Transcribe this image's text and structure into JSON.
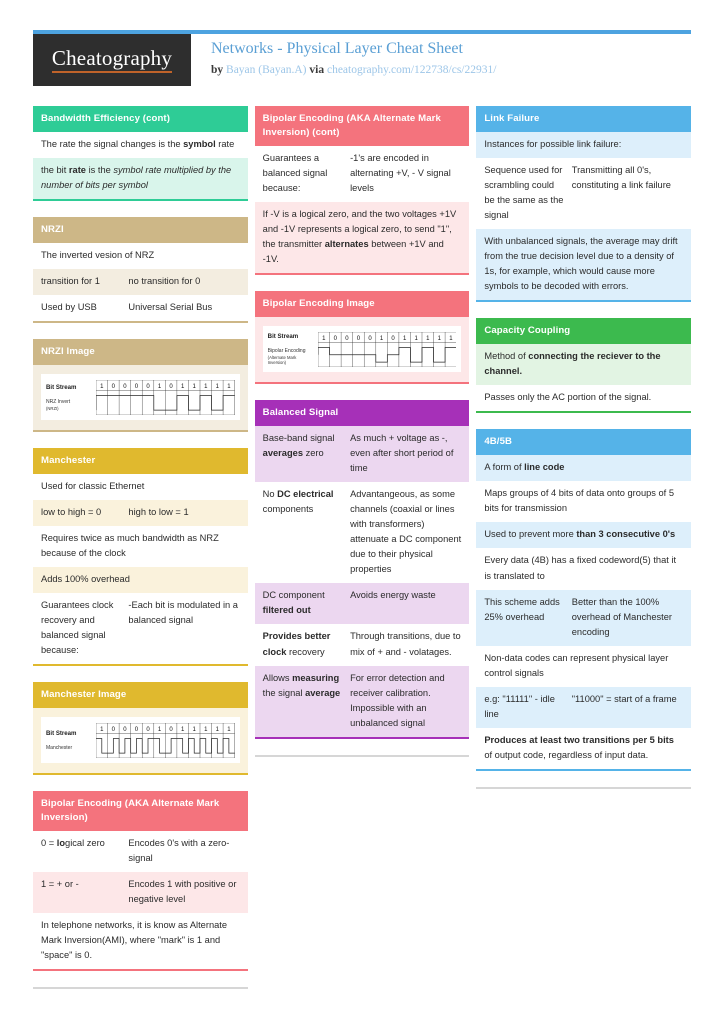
{
  "brand": {
    "logo": "Cheatography",
    "topbar_color": "#4da3e0"
  },
  "header": {
    "title": "Networks - Physical Layer Cheat Sheet",
    "by_label": "by ",
    "author": "Bayan (Bayan.A)",
    "via_label": " via ",
    "url": "cheatography.com/122738/cs/22931/"
  },
  "columns": [
    {
      "cards": [
        {
          "id": "bandwidth-efficiency-cont",
          "title": "Bandwidth Efficiency (cont)",
          "head_color": "#2ecc96",
          "body_border": "#2ecc96",
          "alt_color": "#d9f5eb",
          "rows": [
            {
              "c1": "The rate the signal changes is the <b>symbol</b> rate",
              "single": true,
              "shade": false
            },
            {
              "c1": "the bit <b>rate</b> is the <i>symbol rate multiplied by the number of bits per symbol</i>",
              "single": true,
              "shade": true
            }
          ]
        },
        {
          "id": "nrzi",
          "title": "NRZI",
          "head_color": "#cdb787",
          "body_border": "#cdb787",
          "alt_color": "#f3ede0",
          "rows": [
            {
              "c1": "The inverted vesion of NRZ",
              "single": true,
              "shade": false
            },
            {
              "c1": "transition for 1",
              "c2": "no transition for 0",
              "single": false,
              "shade": true
            },
            {
              "c1": "Used by USB",
              "c2": "Universal Serial Bus",
              "single": false,
              "shade": false
            }
          ]
        },
        {
          "id": "nrzi-image",
          "title": "NRZI Image",
          "head_color": "#cdb787",
          "body_border": "#cdb787",
          "alt_color": "#f3ede0",
          "figure": {
            "label_top": "Bit Stream",
            "label_bottom": "NRZ Invert",
            "label_bottom_sub": "(NRZI)",
            "bits": [
              "1",
              "0",
              "0",
              "0",
              "0",
              "1",
              "0",
              "1",
              "1",
              "1",
              "1",
              "1"
            ],
            "waveform": "nrzi"
          }
        },
        {
          "id": "manchester",
          "title": "Manchester",
          "head_color": "#e0b92e",
          "body_border": "#e0b92e",
          "alt_color": "#faf2dc",
          "rows": [
            {
              "c1": "Used for classic Ethernet",
              "single": true,
              "shade": false
            },
            {
              "c1": "low to high = 0",
              "c2": "high to low = 1",
              "single": false,
              "shade": true
            },
            {
              "c1": "Requires twice as much bandwidth as NRZ because of the clock",
              "single": true,
              "shade": false
            },
            {
              "c1": "Adds 100% overhead",
              "single": true,
              "shade": true
            },
            {
              "c1": "Guarantees clock recovery and balanced signal because:",
              "c2": "-Each bit is modulated in a balanced signal",
              "single": false,
              "shade": false
            }
          ]
        },
        {
          "id": "manchester-image",
          "title": "Manchester Image",
          "head_color": "#e0b92e",
          "body_border": "#e0b92e",
          "alt_color": "#faf2dc",
          "figure": {
            "label_top": "Bit Stream",
            "label_bottom": "Manchester",
            "label_bottom_sub": "",
            "bits": [
              "1",
              "0",
              "0",
              "0",
              "0",
              "1",
              "0",
              "1",
              "1",
              "1",
              "1",
              "1"
            ],
            "waveform": "manchester"
          }
        },
        {
          "id": "bipolar-encoding",
          "title": "Bipolar Encoding (AKA Alternate Mark Inversion)",
          "head_color": "#f4737d",
          "body_border": "#f4737d",
          "alt_color": "#fde7e8",
          "rows": [
            {
              "c1": "0 = <b>lo</b>gical zero",
              "c2": "Encodes 0's with a zero-signal",
              "single": false,
              "shade": false
            },
            {
              "c1": "1 = + or -",
              "c2": "Encodes 1 with positive or negative level",
              "single": false,
              "shade": true
            },
            {
              "c1": "In telephone networks, it is know as Alternate Mark Inversion(AMI), where \"mark\" is 1 and \"space\" is 0.",
              "single": true,
              "shade": false
            }
          ]
        }
      ]
    },
    {
      "cards": [
        {
          "id": "bipolar-encoding-cont",
          "title": "Bipolar Encoding (AKA Alternate Mark Inversion) (cont)",
          "head_color": "#f4737d",
          "body_border": "#f4737d",
          "alt_color": "#fde7e8",
          "rows": [
            {
              "c1": "Guarantees a balanced signal because:",
              "c2": "-1's are encoded in alternating +V, - V signal levels",
              "single": false,
              "shade": false
            },
            {
              "c1": "If -V is a logical zero, and the two voltages +1V and -1V represents a logical zero, to send \"1\", the transmitter <b>alternates</b> between +1V and -1V.",
              "single": true,
              "shade": true
            }
          ]
        },
        {
          "id": "bipolar-encoding-image",
          "title": "Bipolar Encoding Image",
          "head_color": "#f4737d",
          "body_border": "#f4737d",
          "alt_color": "#fde7e8",
          "figure": {
            "label_top": "Bit Stream",
            "label_bottom": "Bipolar Encoding",
            "label_bottom_sub": "(Alternate Mark Inversion)",
            "bits": [
              "1",
              "0",
              "0",
              "0",
              "0",
              "1",
              "0",
              "1",
              "1",
              "1",
              "1",
              "1"
            ],
            "waveform": "bipolar"
          }
        },
        {
          "id": "balanced-signal",
          "title": "Balanced Signal",
          "head_color": "#a630b8",
          "body_border": "#a630b8",
          "alt_color": "#ecd7f0",
          "rows": [
            {
              "c1": "Base-band signal <b>averages</b> zero",
              "c2": "As much + voltage as -, even after short period of time",
              "single": false,
              "shade": true
            },
            {
              "c1": "No <b>DC electrical</b> components",
              "c2": "Advantangeous, as some channels (coaxial or lines with transformers) attenuate a DC component due to their physical properties",
              "single": false,
              "shade": false
            },
            {
              "c1": "DC component <b>filtered out</b>",
              "c2": "Avoids energy waste",
              "single": false,
              "shade": true
            },
            {
              "c1": "<b>Provides better clock</b> recovery",
              "c2": "Through transitions, due to mix of + and - volatages.",
              "single": false,
              "shade": false
            },
            {
              "c1": "Allows <b>measuring</b> the signal <b>average</b>",
              "c2": "For error detection and receiver calibration. Impossible with an unbalanced signal",
              "single": false,
              "shade": true
            }
          ]
        }
      ]
    },
    {
      "cards": [
        {
          "id": "link-failure",
          "title": "Link Failure",
          "head_color": "#55b3e8",
          "body_border": "#55b3e8",
          "alt_color": "#ddeffb",
          "rows": [
            {
              "c1": "Instances for possible link failure:",
              "single": true,
              "shade": true
            },
            {
              "c1": "Sequence used for scrambling could be the same as the signal",
              "c2": "Transmitting all 0's, constituting a link failure",
              "single": false,
              "shade": false
            },
            {
              "c1": "With unbalanced signals, the average may drift from the true decision level due to a density of 1s, for example, which would cause more symbols to be decoded with errors.",
              "single": true,
              "shade": true
            }
          ]
        },
        {
          "id": "capacity-coupling",
          "title": "Capacity Coupling",
          "head_color": "#3cba4e",
          "body_border": "#3cba4e",
          "alt_color": "#e2f4e3",
          "rows": [
            {
              "c1": "Method of <b>connecting the reciever to the channel.</b>",
              "single": true,
              "shade": true
            },
            {
              "c1": "Passes only the AC portion of the signal.",
              "single": true,
              "shade": false
            }
          ]
        },
        {
          "id": "4b5b",
          "title": "4B/5B",
          "head_color": "#55b3e8",
          "body_border": "#55b3e8",
          "alt_color": "#ddeffb",
          "rows": [
            {
              "c1": "A form of <b>line code</b>",
              "single": true,
              "shade": true
            },
            {
              "c1": "Maps groups of 4 bits of data onto groups of 5 bits for transmission",
              "single": true,
              "shade": false
            },
            {
              "c1": "Used to prevent more <b>than 3 consecutive 0's</b>",
              "single": true,
              "shade": true
            },
            {
              "c1": "Every data (4B) has a fixed codeword(5) that it is translated to",
              "single": true,
              "shade": false
            },
            {
              "c1": "This scheme adds 25% overhead",
              "c2": "Better than the 100% overhead of Manchester encoding",
              "single": false,
              "shade": true
            },
            {
              "c1": "Non-data codes can represent physical layer control signals",
              "single": true,
              "shade": false
            },
            {
              "c1": "e.g: \"11111\" - idle line",
              "c2": "\"11000\" = start of a frame",
              "single": false,
              "shade": true
            },
            {
              "c1": "<b>Produces at least two transitions per 5 bits</b> of output code, regardless of input data.",
              "single": true,
              "shade": false
            }
          ]
        }
      ]
    }
  ]
}
